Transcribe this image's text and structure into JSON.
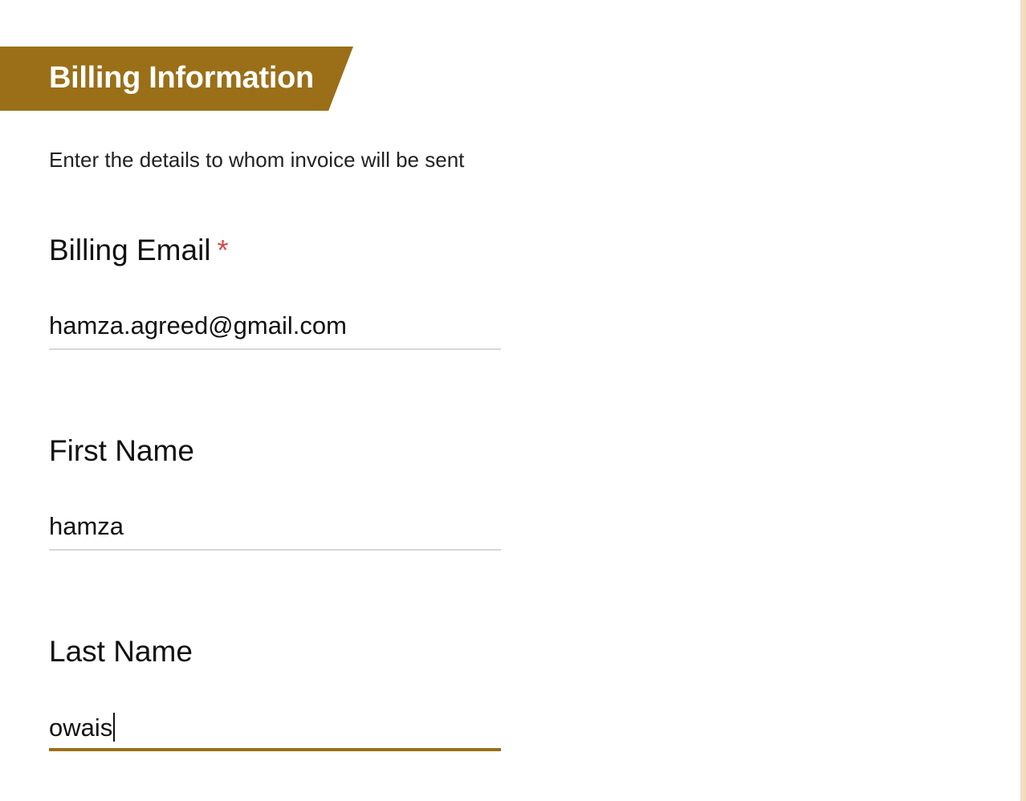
{
  "section": {
    "title": "Billing Information",
    "subtitle": "Enter the details to whom invoice will be sent"
  },
  "fields": {
    "billing_email": {
      "label": "Billing Email",
      "required_marker": "*",
      "value": "hamza.agreed@gmail.com"
    },
    "first_name": {
      "label": "First Name",
      "value": "hamza"
    },
    "last_name": {
      "label": "Last Name",
      "value": "owais",
      "focused": true
    }
  },
  "colors": {
    "accent": "#9a6f18",
    "required": "#d04a4a",
    "divider": "#d7d7d7"
  }
}
